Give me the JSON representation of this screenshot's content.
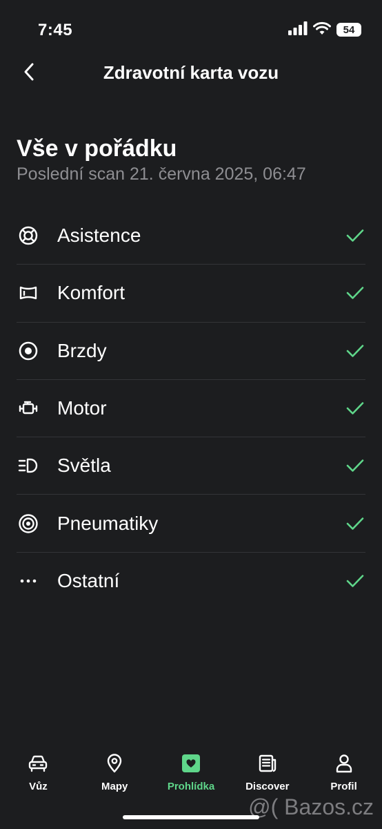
{
  "status_bar": {
    "time": "7:45",
    "battery": "54",
    "icons": [
      "signal-icon",
      "wifi-icon",
      "battery-icon"
    ]
  },
  "header": {
    "title": "Zdravotní karta vozu",
    "back_icon": "chevron-left-icon"
  },
  "summary": {
    "title": "Vše v pořádku",
    "subtitle": "Poslední scan 21. června 2025, 06:47"
  },
  "checks": [
    {
      "label": "Asistence",
      "icon": "lifebuoy-icon",
      "status": "ok"
    },
    {
      "label": "Komfort",
      "icon": "seat-icon",
      "status": "ok"
    },
    {
      "label": "Brzdy",
      "icon": "brake-disc-icon",
      "status": "ok"
    },
    {
      "label": "Motor",
      "icon": "engine-icon",
      "status": "ok"
    },
    {
      "label": "Světla",
      "icon": "headlight-icon",
      "status": "ok"
    },
    {
      "label": "Pneumatiky",
      "icon": "tire-icon",
      "status": "ok"
    },
    {
      "label": "Ostatní",
      "icon": "more-dots-icon",
      "status": "ok"
    }
  ],
  "tabs": [
    {
      "label": "Vůz",
      "icon": "car-icon",
      "active": false
    },
    {
      "label": "Mapy",
      "icon": "map-pin-icon",
      "active": false
    },
    {
      "label": "Prohlídka",
      "icon": "health-heart-icon",
      "active": true
    },
    {
      "label": "Discover",
      "icon": "news-icon",
      "active": false
    },
    {
      "label": "Profil",
      "icon": "user-icon",
      "active": false
    }
  ],
  "watermark": "@( Bazos.cz",
  "colors": {
    "background": "#1c1d1f",
    "accent": "#5fd68a",
    "muted_text": "#8e8e92",
    "divider": "#343538"
  }
}
